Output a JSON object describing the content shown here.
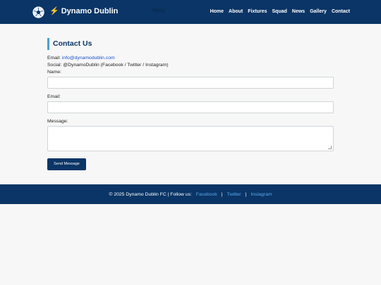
{
  "header": {
    "logo_icon": "soccer-ball-icon",
    "brand_icon": "lightning-bolt-icon",
    "brand_name": "Dynamo Dublin",
    "menu_toggle_label": "Menu",
    "nav": [
      "Home",
      "About",
      "Fixtures",
      "Squad",
      "News",
      "Gallery",
      "Contact"
    ]
  },
  "contact": {
    "title": "Contact Us",
    "email_label": "Email:",
    "email_value": "info@dynamodublin.com",
    "social_text": "Social: @DynamoDublin (Facebook / Twitter / Instagram)",
    "form": {
      "name_label": "Name:",
      "email_label": "Email:",
      "message_label": "Message:",
      "submit_label": "Send Message"
    }
  },
  "footer": {
    "copyright": "© 2025 Dynamo Dublin FC | Follow us:",
    "links": [
      "Facebook",
      "Twitter",
      "Instagram"
    ],
    "separator": "|"
  },
  "colors": {
    "header_bg": "#0a3566",
    "accent": "#4a9fd8",
    "link": "#1a4fcf",
    "footer_link": "#5aa9ea",
    "page_bg": "#f7f7f7"
  }
}
